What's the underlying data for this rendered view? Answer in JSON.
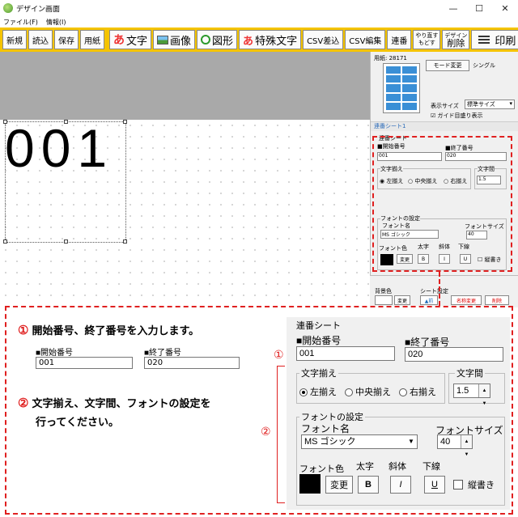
{
  "window": {
    "title": "デザイン画面",
    "minimize": "—",
    "maximize": "☐",
    "close": "✕"
  },
  "menu": [
    "ファイル(F)",
    "情報(I)"
  ],
  "toolbar": {
    "new": "新規",
    "open": "読込",
    "save": "保存",
    "paper": "用紙",
    "text": "文字",
    "image": "画像",
    "shape": "図形",
    "special_text": "特殊文字",
    "csv_import": "CSV差込",
    "csv_edit": "CSV編集",
    "serial": "連番",
    "redo": "やり直す",
    "undo": "もどす",
    "design_label": "デザイン",
    "delete": "削除",
    "print": "印刷",
    "text_icon": "あ",
    "special_icon": "あ"
  },
  "canvas": {
    "text": "001"
  },
  "right_panel": {
    "paper_label": "用紙: 28171",
    "mode_button": "モード変更",
    "mode_value": "シングル",
    "display_size_label": "表示サイズ",
    "display_size_value": "標準サイズ",
    "guide_checkbox": "ガイド目盛り表示",
    "sheet_tab": "連番シート1",
    "mini": {
      "title": "連番シート",
      "start_label": "■開始番号",
      "end_label": "■終了番号",
      "start_value": "001",
      "end_value": "020",
      "align_group": "文字揃え",
      "align_left": "左揃え",
      "align_center": "中央揃え",
      "align_right": "右揃え",
      "spacing_group": "文字間",
      "spacing_value": "1.5",
      "font_group": "フォントの設定",
      "font_name_label": "フォント名",
      "font_name_value": "MS ゴシック",
      "font_size_label": "フォントサイズ",
      "font_size_value": "40",
      "font_color_label": "フォント色",
      "bold_label": "太字",
      "italic_label": "斜体",
      "underline_label": "下線",
      "change_button": "変更",
      "bold_button": "B",
      "italic_button": "I",
      "underline_button": "U",
      "vertical_label": "縦書き"
    },
    "bottom": {
      "bg_color_label": "背景色",
      "change": "変更",
      "sheet_settings": "シート設定",
      "prev": "▲前",
      "rename": "名称変更",
      "delete": "削除"
    }
  },
  "callout": {
    "step1_num": "①",
    "step1": "開始番号、終了番号を入力します。",
    "step2_num": "②",
    "step2_line1": "文字揃え、文字間、フォントの設定を",
    "step2_line2": "行ってください。",
    "start_label": "■開始番号",
    "end_label": "■終了番号",
    "start_value": "001",
    "end_value": "020"
  },
  "big_panel": {
    "title": "連番シート",
    "start_label": "■開始番号",
    "end_label": "■終了番号",
    "start_value": "001",
    "end_value": "020",
    "marker1": "①",
    "marker2": "②",
    "align_group": "文字揃え",
    "align_left": "左揃え",
    "align_center": "中央揃え",
    "align_right": "右揃え",
    "spacing_group": "文字間",
    "spacing_value": "1.5",
    "font_group": "フォントの設定",
    "font_name_label": "フォント名",
    "font_name_value": "MS ゴシック",
    "font_size_label": "フォントサイズ",
    "font_size_value": "40",
    "font_color_label": "フォント色",
    "bold_label": "太字",
    "italic_label": "斜体",
    "underline_label": "下線",
    "change_button": "変更",
    "bold_button": "B",
    "italic_button": "I",
    "underline_button": "U",
    "vertical_label": "縦書き"
  }
}
